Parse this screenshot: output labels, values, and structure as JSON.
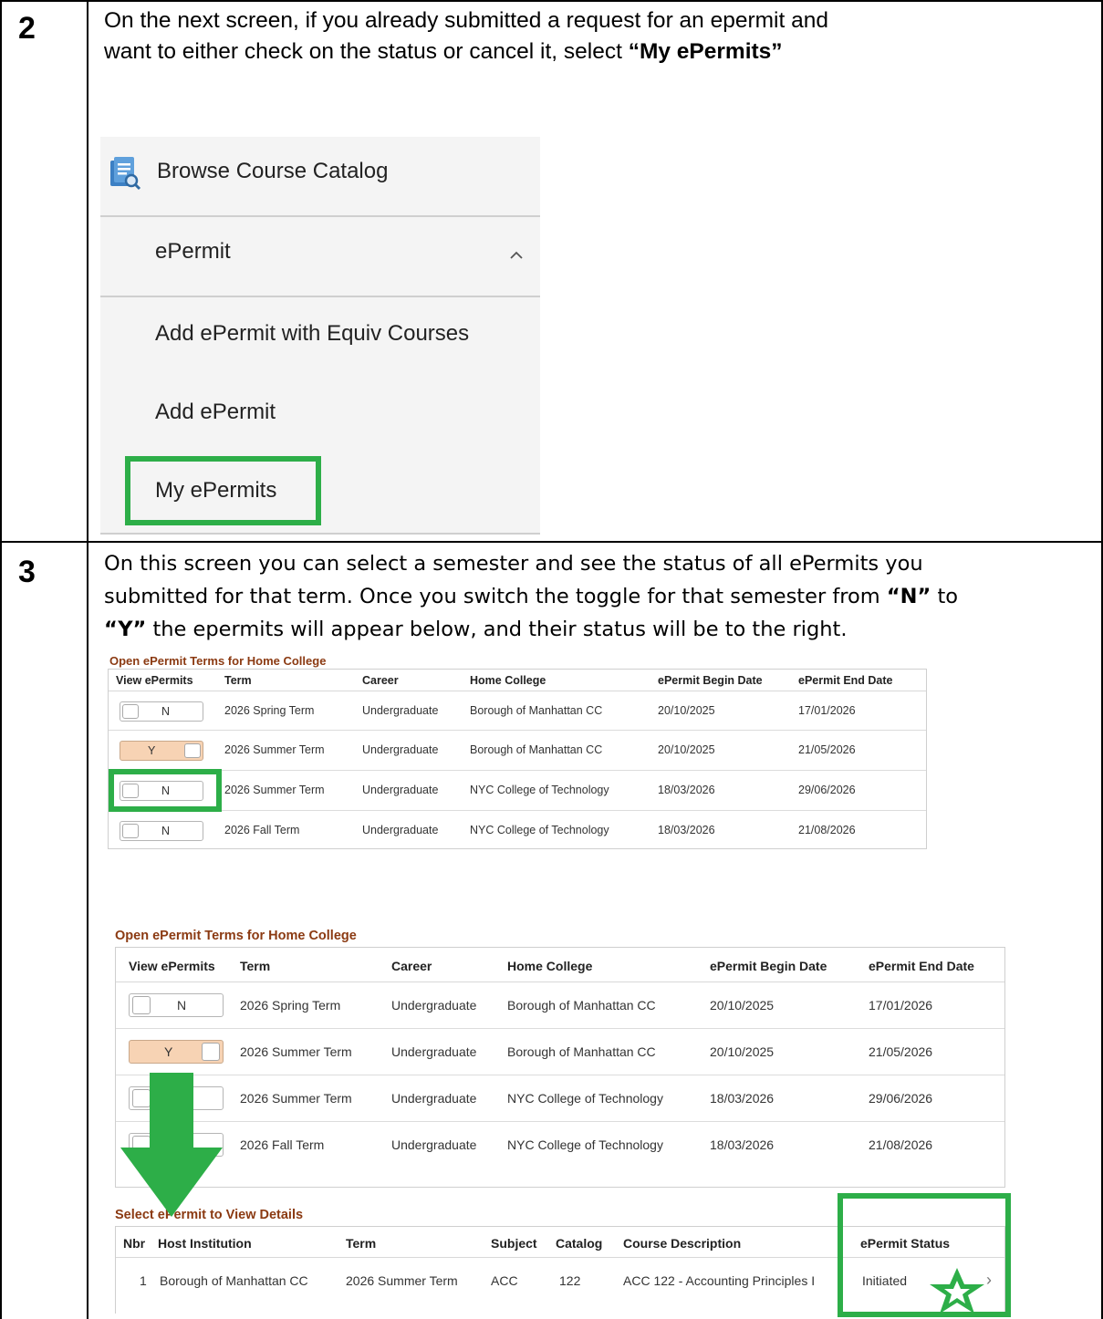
{
  "step2": {
    "number": "2",
    "text_line1": "On the next screen, if you already submitted a request for an epermit and",
    "text_line2_plain": "want to either check on the status or cancel it, select ",
    "text_line2_bold": "“My ePermits”",
    "menu": {
      "browse_catalog": "Browse Course Catalog",
      "epermit_header": "ePermit",
      "add_equiv": "Add ePermit with Equiv Courses",
      "add_epermit": "Add ePermit",
      "my_epermits": "My ePermits"
    },
    "highlight_color": "#2dae48"
  },
  "step3": {
    "number": "3",
    "line1": "On this screen you can select a semester and see the status of all ePermits you",
    "line2_plain": "submitted for that term. Once you switch the toggle for that semester from ",
    "line2_bold": "“N”",
    "line2_end": " to",
    "line3_bold": "“Y”",
    "line3_plain": " the epermits will appear below, and their status will be to the right.",
    "terms_title": "Open ePermit Terms for Home College",
    "terms_headers": [
      "View ePermits",
      "Term",
      "Career",
      "Home College",
      "ePermit Begin Date",
      "ePermit End Date"
    ],
    "terms_rows": [
      {
        "toggle": "N",
        "term": "2026 Spring Term",
        "career": "Undergraduate",
        "college": "Borough of Manhattan CC",
        "begin": "20/10/2025",
        "end": "17/01/2026"
      },
      {
        "toggle": "Y",
        "term": "2026 Summer Term",
        "career": "Undergraduate",
        "college": "Borough of Manhattan CC",
        "begin": "20/10/2025",
        "end": "21/05/2026"
      },
      {
        "toggle": "N",
        "term": "2026 Summer Term",
        "career": "Undergraduate",
        "college": "NYC College of Technology",
        "begin": "18/03/2026",
        "end": "29/06/2026"
      },
      {
        "toggle": "N",
        "term": "2026 Fall Term",
        "career": "Undergraduate",
        "college": "NYC College of Technology",
        "begin": "18/03/2026",
        "end": "21/08/2026"
      }
    ],
    "details_title": "Select ePermit to View Details",
    "details_headers": [
      "Nbr",
      "Host Institution",
      "Term",
      "Subject",
      "Catalog",
      "Course Description",
      "ePermit Status"
    ],
    "details_row": {
      "nbr": "1",
      "host": "Borough of Manhattan CC",
      "term": "2026 Summer Term",
      "subject": "ACC",
      "catalog": "122",
      "description": "ACC 122 - Accounting Principles I",
      "status": "Initiated"
    },
    "title_color": "#8b3a12",
    "toggle_on_color": "#f7d3b4",
    "arrow_color": "#2dae48"
  }
}
